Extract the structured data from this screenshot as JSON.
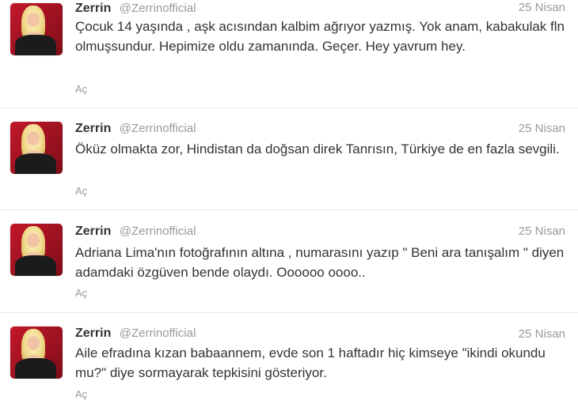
{
  "tweets": [
    {
      "name": "Zerrin",
      "handle": "@Zerrinofficial",
      "time": "25 Nisan",
      "text": "Çocuk 14 yaşında , aşk acısından kalbim ağrıyor yazmış. Yok anam, kabakulak fln olmuşsundur. Hepimize oldu zamanında. Geçer. Hey yavrum hey.",
      "action": "Aç"
    },
    {
      "name": "Zerrin",
      "handle": "@Zerrinofficial",
      "time": "25 Nisan",
      "text": "Öküz olmakta zor, Hindistan da doğsan direk Tanrısın, Türkiye de en fazla sevgili.",
      "action": "Aç"
    },
    {
      "name": "Zerrin",
      "handle": "@Zerrinofficial",
      "time": "25 Nisan",
      "text": "Adriana Lima'nın fotoğrafının altına , numarasını yazıp \" Beni ara tanışalım \" diyen adamdaki özgüven bende olaydı. Oooooo oooo..",
      "action": "Aç"
    },
    {
      "name": "Zerrin",
      "handle": "@Zerrinofficial",
      "time": "25 Nisan",
      "text": "Aile efradına kızan babaannem, evde son 1 haftadır hiç kimseye \"ikindi okundu mu?\" diye sormayarak tepkisini gösteriyor.",
      "action": "Aç"
    }
  ]
}
